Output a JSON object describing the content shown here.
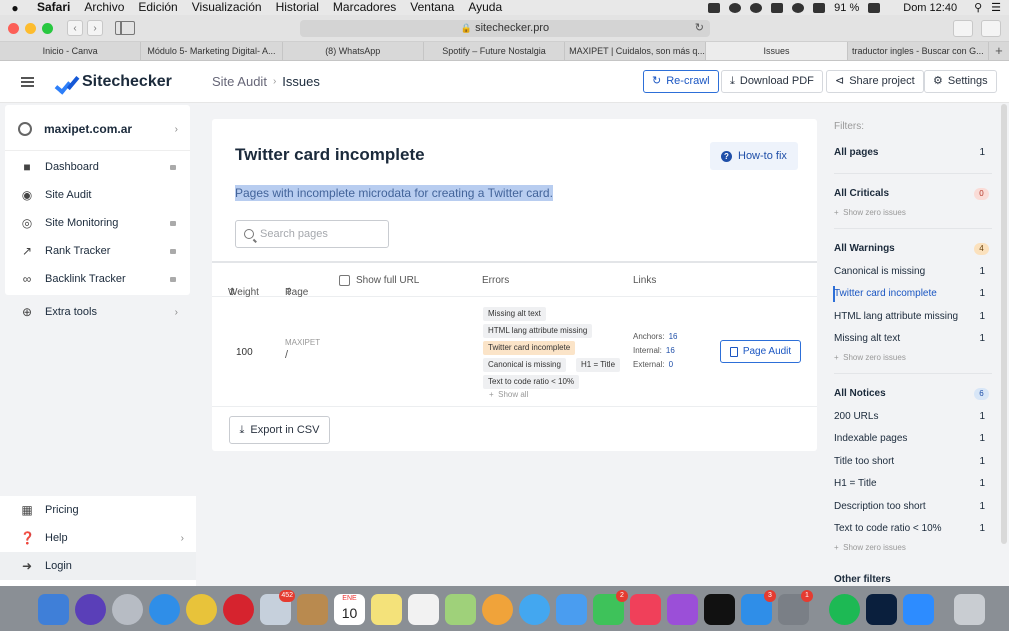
{
  "menubar": {
    "apple": "",
    "items": [
      "Safari",
      "Archivo",
      "Edición",
      "Visualización",
      "Historial",
      "Marcadores",
      "Ventana",
      "Ayuda"
    ],
    "battery": "91 %",
    "clock": "Dom 12:40"
  },
  "browser": {
    "url": "sitechecker.pro",
    "tabs": [
      {
        "label": "Inicio - Canva"
      },
      {
        "label": "Módulo 5- Marketing Digital- A..."
      },
      {
        "label": "(8) WhatsApp"
      },
      {
        "label": "Spotify – Future Nostalgia"
      },
      {
        "label": "MAXIPET | Cuidalos, son más q..."
      },
      {
        "label": "Issues"
      },
      {
        "label": "traductor ingles - Buscar con G..."
      }
    ],
    "new_tab": "+"
  },
  "header": {
    "logo": "Sitechecker",
    "breadcrumb": {
      "parent": "Site Audit",
      "separator": "›",
      "current": "Issues"
    },
    "buttons": {
      "recrawl": "Re-crawl",
      "download": "Download PDF",
      "share": "Share project",
      "settings": "Settings"
    }
  },
  "sidebar": {
    "site": "maxipet.com.ar",
    "items": [
      {
        "label": "Dashboard",
        "icon": "dashboard-icon"
      },
      {
        "label": "Site Audit",
        "icon": "site-audit-icon"
      },
      {
        "label": "Site Monitoring",
        "icon": "monitoring-icon"
      },
      {
        "label": "Rank Tracker",
        "icon": "rank-icon"
      },
      {
        "label": "Backlink Tracker",
        "icon": "link-icon"
      }
    ],
    "extra": "Extra tools",
    "bottom": {
      "pricing": "Pricing",
      "help": "Help",
      "login": "Login"
    }
  },
  "issue": {
    "title": "Twitter card incomplete",
    "howto": "How-to fix",
    "description": "Pages with incomplete microdata for creating a Twitter card.",
    "search_placeholder": "Search pages",
    "columns": {
      "weight": "Weight",
      "page": "Page",
      "show_full_url": "Show full URL",
      "errors": "Errors",
      "links": "Links"
    },
    "row": {
      "weight": "100",
      "page_label": "MAXIPET",
      "page_path": "/",
      "errors": [
        "Missing alt text",
        "HTML lang attribute missing",
        "Twitter card incomplete",
        "Canonical is missing",
        "H1 = Title",
        "Text to code ratio < 10%"
      ],
      "show_all": "Show all",
      "anchors_label": "Anchors:",
      "anchors": "16",
      "internal_label": "Internal:",
      "internal": "16",
      "external_label": "External:",
      "external": "0",
      "page_audit": "Page Audit"
    },
    "export": "Export in CSV"
  },
  "filters": {
    "title": "Filters:",
    "all_pages": {
      "label": "All pages",
      "count": "1"
    },
    "criticals": {
      "label": "All Criticals",
      "count": "0"
    },
    "criticals_zero": "Show zero issues",
    "warnings": {
      "label": "All Warnings",
      "count": "4"
    },
    "warning_items": [
      {
        "label": "Canonical is missing",
        "count": "1"
      },
      {
        "label": "Twitter card incomplete",
        "count": "1"
      },
      {
        "label": "HTML lang attribute missing",
        "count": "1"
      },
      {
        "label": "Missing alt text",
        "count": "1"
      }
    ],
    "warnings_zero": "Show zero issues",
    "notices": {
      "label": "All Notices",
      "count": "6"
    },
    "notice_items": [
      {
        "label": "200 URLs",
        "count": "1"
      },
      {
        "label": "Indexable pages",
        "count": "1"
      },
      {
        "label": "Title too short",
        "count": "1"
      },
      {
        "label": "H1 = Title",
        "count": "1"
      },
      {
        "label": "Description too short",
        "count": "1"
      },
      {
        "label": "Text to code ratio < 10%",
        "count": "1"
      }
    ],
    "notices_zero": "Show zero issues",
    "other": "Other filters"
  },
  "dock": {
    "badges": {
      "photos": "452",
      "calendar_month": "ENE",
      "calendar_day": "10",
      "facetime": "2",
      "appstore": "3",
      "prefs": "1"
    }
  },
  "colors": {
    "accent": "#2d6fd8",
    "warn_tag": "#fbe4c8",
    "critical_badge": "#fadcd7",
    "warning_badge": "#fbe1bd",
    "notice_badge": "#d8e6f7"
  }
}
